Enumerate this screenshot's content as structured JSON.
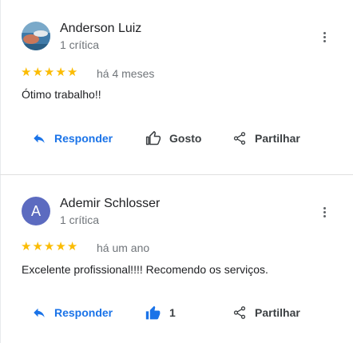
{
  "reviews": [
    {
      "author": "Anderson Luiz",
      "review_count": "1 crítica",
      "avatar_letter": "",
      "rating": 5,
      "date": "há 4 meses",
      "text": "Ótimo trabalho!!",
      "actions": {
        "reply": "Responder",
        "like": "Gosto",
        "share": "Partilhar"
      }
    },
    {
      "author": "Ademir Schlosser",
      "review_count": "1 crítica",
      "avatar_letter": "A",
      "rating": 5,
      "date": "há um ano",
      "text": "Excelente profissional!!!! Recomendo os serviços.",
      "actions": {
        "reply": "Responder",
        "like": "1",
        "share": "Partilhar"
      }
    }
  ],
  "colors": {
    "accent": "#1a73e8",
    "star": "#fbbc04",
    "avatar": "#5c6bc0"
  },
  "icons": {
    "reply": "reply-arrow-icon",
    "like": "thumb-up-icon",
    "share": "share-icon",
    "more": "more-vert-icon",
    "star": "star-icon"
  }
}
